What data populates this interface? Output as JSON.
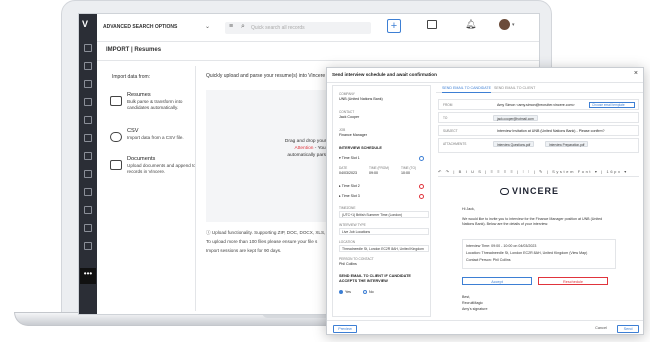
{
  "topbar": {
    "advanced_search": "ADVANCED SEARCH OPTIONS",
    "search_placeholder": "Quick search all records"
  },
  "page": {
    "title": "IMPORT  |  Resumes",
    "import_from": "Import data from:",
    "options": [
      {
        "title": "Resumes",
        "desc": "Bulk parse & transform into candidates automatically.",
        "icon": "id-card-icon"
      },
      {
        "title": "CSV",
        "desc": "Import data from a CSV file.",
        "icon": "cloud-upload-icon"
      },
      {
        "title": "Documents",
        "desc": "Upload documents and append to records in Vincere.",
        "icon": "documents-icon"
      }
    ],
    "right_heading": "Quickly upload and parse your resume(s) into Vincere",
    "drop_text": "Drag and drop your files here",
    "attention": "Attention",
    "attention_rest": " - You have",
    "drop_text2": "automatically parse all files",
    "notes": [
      "Upload functionality. Supporting ZIP, DOC, DOCX, XLS, XLS",
      "To upload more than 100 files please ensure your file s",
      "Import sessions are kept for 90 days."
    ]
  },
  "modal": {
    "title": "Send interview schedule and await confirmation",
    "close": "×",
    "company_label": "COMPANY",
    "company": "UNB (United Nations Bank)",
    "contact_label": "CONTACT",
    "contact": "Jack Cooper",
    "job_label": "JOB",
    "job": "Finance Manager",
    "schedule_heading": "INTERVIEW SCHEDULE",
    "slots": [
      "Time Slot 1",
      "Time Slot 2",
      "Time Slot 3"
    ],
    "date_label": "DATE",
    "date": "04/03/2023",
    "time_from_label": "TIME (FROM)",
    "time_from": "09:00",
    "time_to_label": "TIME (TO)",
    "time_to": "10:00",
    "timezone_label": "TIMEZONE",
    "timezone": "(UTC+1) British Summer Time (London)",
    "interview_type_label": "INTERVIEW TYPE",
    "interview_type": "Live Job Locations",
    "location_label": "LOCATION",
    "location": "Threadneedle St, London EC2R 8AH, United Kingdom",
    "person_label": "PERSON TO CONTACT",
    "person": "Phil Collins",
    "send_email_heading": "SEND EMAIL TO CLIENT IF CANDIDATE ACCEPTS THE INTERVIEW",
    "radio_yes": "Yes",
    "radio_no": "No",
    "tab_candidate": "SEND EMAIL TO CANDIDATE",
    "tab_client": "SEND EMAIL TO CLIENT",
    "from_label": "FROM",
    "from": "Amy Simon  <amy.simon@recruiter.vincere.com>",
    "template": "Choose email template",
    "to_label": "TO",
    "to_chip": "jack.cooper@hotmail.com",
    "subject_label": "SUBJECT",
    "subject": "Interview Invitation at UNB (United Nations Bank) - Please confirm?",
    "attach_label": "ATTACHMENTS",
    "attachments": [
      "Interview Questions.pdf",
      "Interview Preparation.pdf"
    ],
    "toolbar": "↶ ↷ | B I U S | ≡ ≡ ≡ ≡ | ⁝ ⁝ | ✎ | System Font ▾ | 16px ▾",
    "brand": "VINCERE",
    "greeting": "Hi Jack,",
    "body": "We would like to invite you to interview for the Finance Manager position at UNB (United Nations Bank). Below are the details of your interview:",
    "interview_time": "Interview Time: 09:00 - 10:00 on 04/03/2023",
    "location_line": "Location: Threadneedle St, London EC2R 8AH, United Kingdom (View Map)",
    "contact_line": "Contact Person: Phil Collins",
    "accept": "Accept",
    "reschedule": "Reschedule",
    "sign1": "Best,",
    "sign2": "RecruitMagic",
    "sign3": "Amy's signature",
    "preview": "Preview",
    "cancel": "Cancel",
    "send": "Send"
  },
  "colors": {
    "accent": "#3d7fd4",
    "danger": "#e0343c",
    "sidebar": "#2b2e36"
  }
}
